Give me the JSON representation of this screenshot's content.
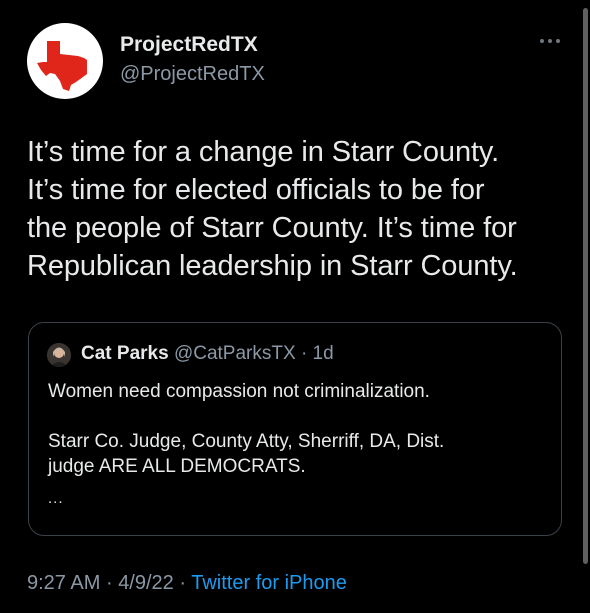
{
  "author": {
    "display_name": "ProjectRedTX",
    "handle": "@ProjectRedTX",
    "avatar_icon": "texas-map-icon",
    "avatar_color": "#e0251b"
  },
  "tweet": {
    "lines": [
      "It’s time for a change in Starr County.",
      "It’s time for elected officials to be for",
      "the people of Starr County. It’s time for",
      "Republican leadership in Starr County."
    ]
  },
  "quote": {
    "display_name": "Cat Parks",
    "handle": "@CatParksTX",
    "time": "· 1d",
    "lines": [
      "Women need compassion not criminalization.",
      "",
      "Starr Co. Judge, County Atty, Sherriff, DA, Dist.",
      "judge ARE ALL DEMOCRATS."
    ],
    "truncation": "..."
  },
  "meta": {
    "time": "9:27 AM",
    "date": "4/9/22",
    "source": "Twitter for iPhone",
    "separator": "·"
  },
  "more_icon": "more-options-icon",
  "colors": {
    "background": "#000000",
    "text": "#e7e9ea",
    "secondary": "#8b98a5",
    "link": "#1d9bf0",
    "border": "#3b4148"
  }
}
